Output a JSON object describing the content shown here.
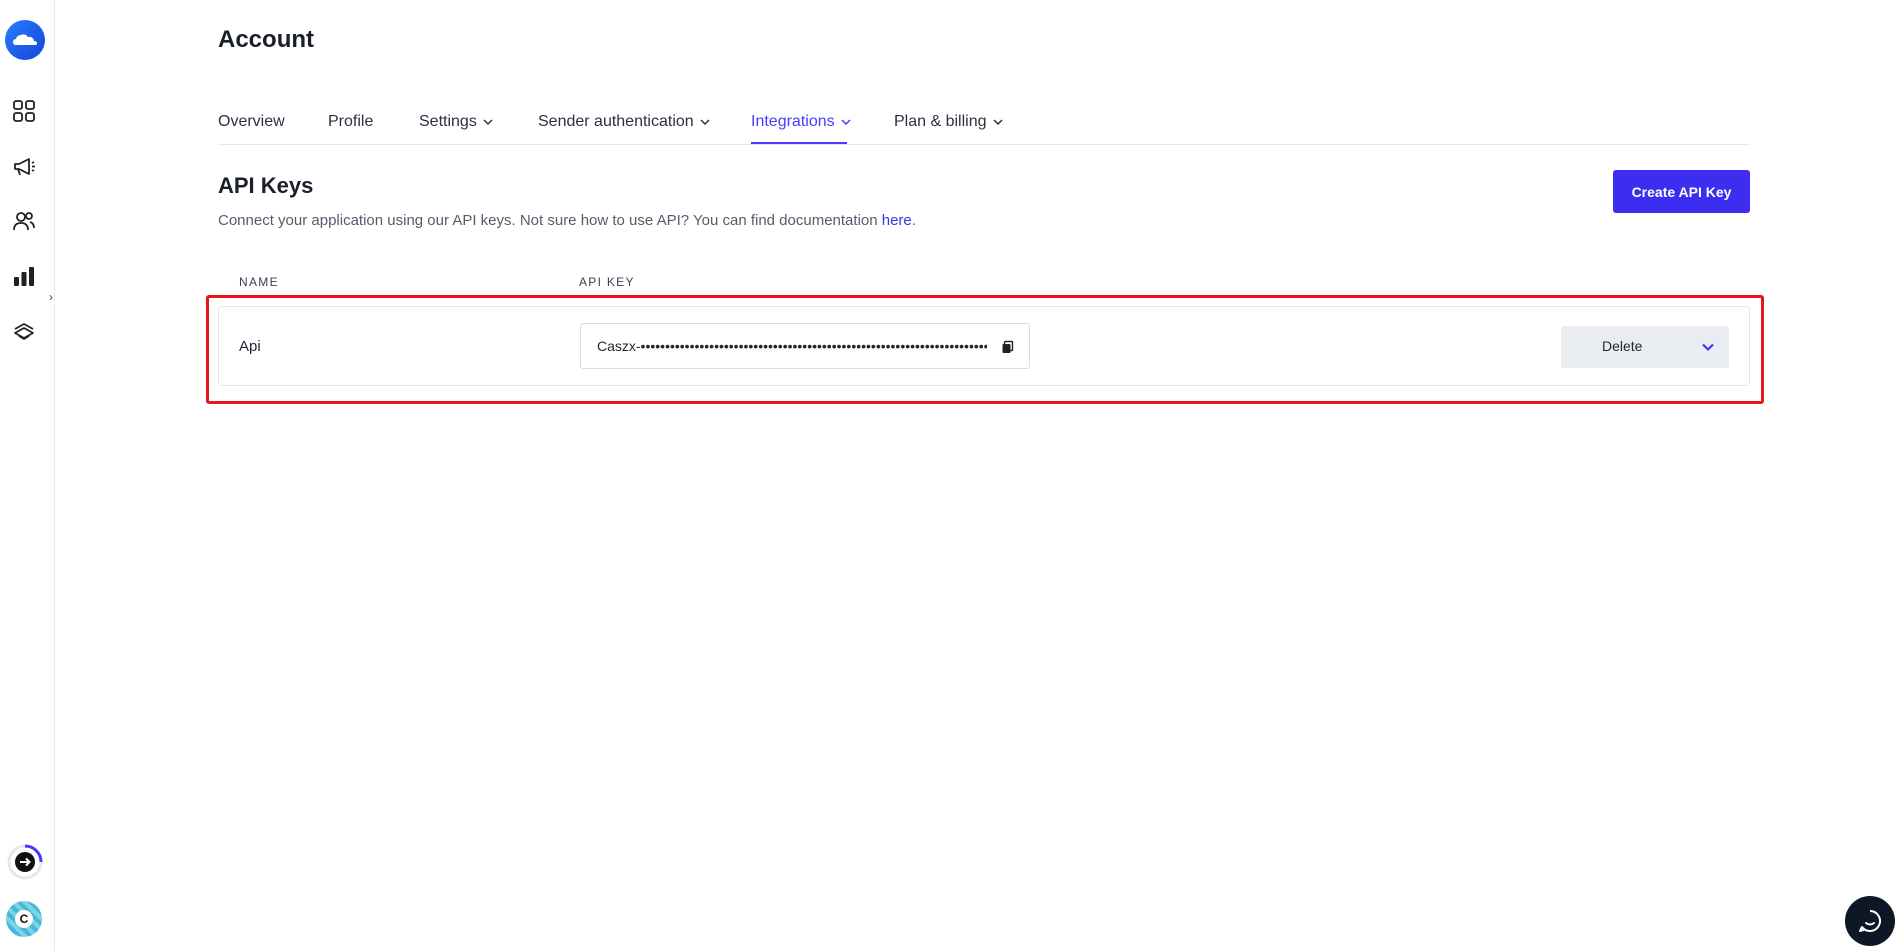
{
  "page": {
    "title": "Account"
  },
  "tabs": [
    {
      "label": "Overview",
      "has_dropdown": false,
      "active": false
    },
    {
      "label": "Profile",
      "has_dropdown": false,
      "active": false
    },
    {
      "label": "Settings",
      "has_dropdown": true,
      "active": false
    },
    {
      "label": "Sender authentication",
      "has_dropdown": true,
      "active": false
    },
    {
      "label": "Integrations",
      "has_dropdown": true,
      "active": true
    },
    {
      "label": "Plan & billing",
      "has_dropdown": true,
      "active": false
    }
  ],
  "api_keys": {
    "title": "API Keys",
    "description": "Connect your application using our API keys. Not sure how to use API? You can find documentation ",
    "doc_link": "here",
    "description_end": ".",
    "create_button": "Create API Key",
    "columns": {
      "name": "NAME",
      "api_key": "API KEY"
    },
    "rows": [
      {
        "name": "Api",
        "key": "Caszx-••••••••••••••••••••••••••••••••••••••••••••••••••••••••••••••••••••••••••••••••••••••",
        "action": "Delete"
      }
    ]
  },
  "sidebar": {
    "icons": [
      "dashboard-icon",
      "campaigns-icon",
      "contacts-icon",
      "statistics-icon",
      "automations-icon"
    ],
    "avatar_initial": "C"
  },
  "colors": {
    "accent": "#4a3aff",
    "button": "#3b2ef0",
    "highlight": "#e8141c"
  }
}
